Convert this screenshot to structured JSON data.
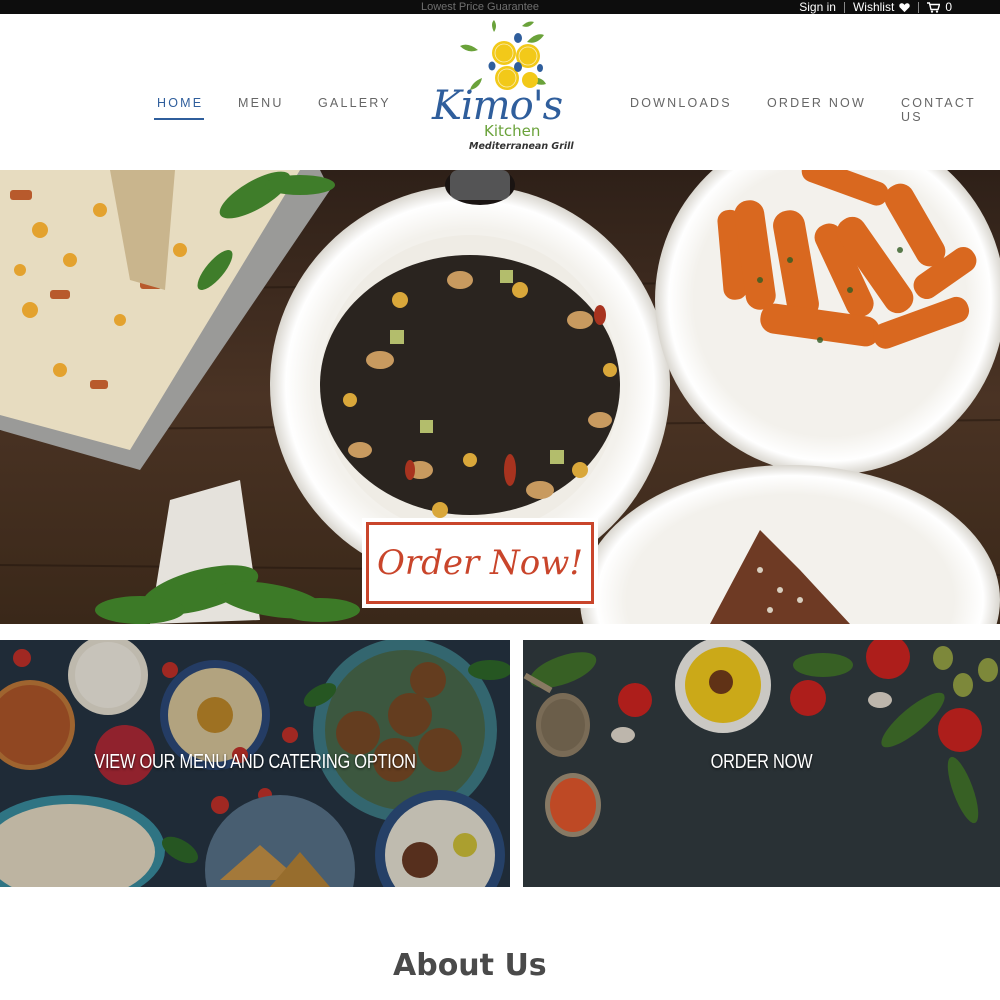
{
  "topbar": {
    "promo": "Lowest Price Guarantee",
    "sign_in": "Sign in",
    "wishlist": "Wishlist",
    "cart_count": "0",
    "icons": [
      "heart-icon",
      "cart-icon"
    ]
  },
  "nav": {
    "left": [
      {
        "label": "HOME",
        "active": true
      },
      {
        "label": "MENU",
        "active": false
      },
      {
        "label": "GALLERY",
        "active": false
      }
    ],
    "right": [
      {
        "label": "DOWNLOADS",
        "active": false
      },
      {
        "label": "ORDER NOW",
        "active": false
      },
      {
        "label": "CONTACT US",
        "active": false
      }
    ]
  },
  "logo": {
    "brand": "Kimo's",
    "brand_sub": "Kitchen",
    "tagline": "Mediterranean Grill"
  },
  "hero": {
    "cta": "Order Now!"
  },
  "tiles": [
    {
      "label": "VIEW OUR MENU AND CATERING OPTION"
    },
    {
      "label": "ORDER NOW"
    }
  ],
  "about": {
    "heading": "About Us"
  },
  "colors": {
    "accent": "#2f5e9c",
    "logo_green": "#6aa23a",
    "logo_yellow": "#f2c919",
    "cta_red": "#c9452b",
    "topbar": "#0d0d0d"
  }
}
